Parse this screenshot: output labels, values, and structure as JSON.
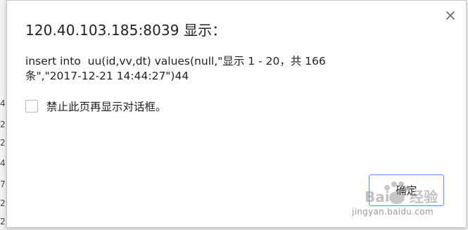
{
  "dialog": {
    "title": "120.40.103.185:8039 显示：",
    "message": "insert into  uu(id,vv,dt) values(null,\"显示 1 - 20，共 166\n条\",\"2017-12-21 14:44:27\")44",
    "suppress_label": "禁止此页再显示对话框。",
    "suppress_checked": false,
    "ok_label": "确定",
    "close_icon": "close-icon",
    "accent_color": "#4d90fe"
  },
  "background": {
    "fragments": [
      "4",
      "2",
      "2",
      "4",
      "7",
      "2",
      "2"
    ]
  },
  "watermark": {
    "brand": "Baidu 经验",
    "url": "jingyan.baidu.com"
  }
}
